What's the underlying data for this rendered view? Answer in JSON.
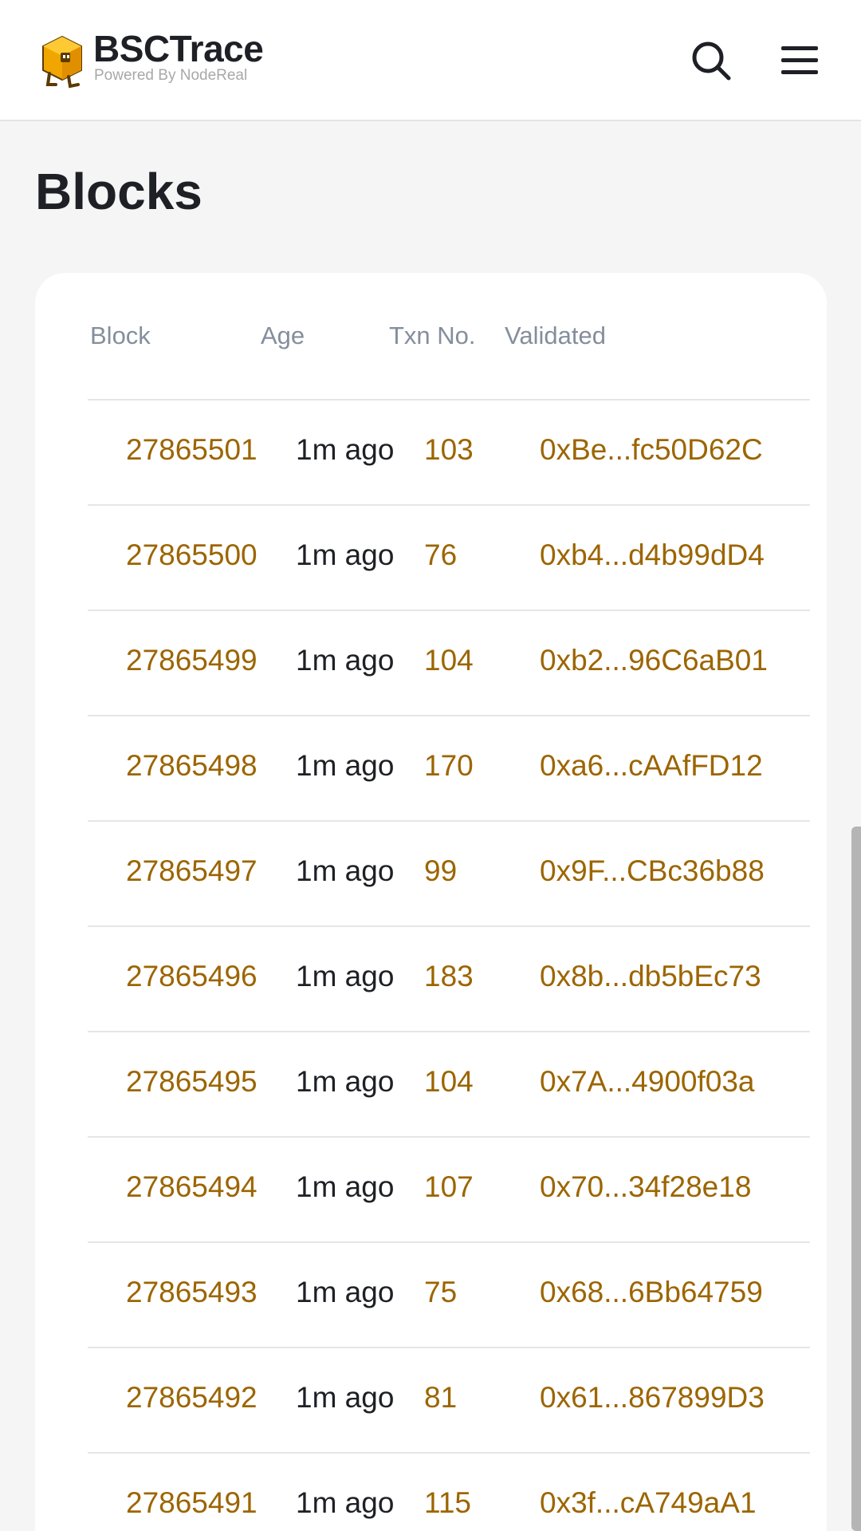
{
  "header": {
    "brand_title": "BSCTrace",
    "brand_subtitle": "Powered By NodeReal",
    "logo_icon": "cube-mascot-icon",
    "search_icon": "search-icon",
    "menu_icon": "hamburger-menu-icon"
  },
  "page": {
    "title": "Blocks"
  },
  "table": {
    "columns": {
      "block": "Block",
      "age": "Age",
      "txn": "Txn No.",
      "validated": "Validated"
    },
    "rows": [
      {
        "block": "27865501",
        "age": "1m ago",
        "txn": "103",
        "validated": "0xBe...fc50D62C"
      },
      {
        "block": "27865500",
        "age": "1m ago",
        "txn": "76",
        "validated": "0xb4...d4b99dD4"
      },
      {
        "block": "27865499",
        "age": "1m ago",
        "txn": "104",
        "validated": "0xb2...96C6aB01"
      },
      {
        "block": "27865498",
        "age": "1m ago",
        "txn": "170",
        "validated": "0xa6...cAAfFD12"
      },
      {
        "block": "27865497",
        "age": "1m ago",
        "txn": "99",
        "validated": "0x9F...CBc36b88"
      },
      {
        "block": "27865496",
        "age": "1m ago",
        "txn": "183",
        "validated": "0x8b...db5bEc73"
      },
      {
        "block": "27865495",
        "age": "1m ago",
        "txn": "104",
        "validated": "0x7A...4900f03a"
      },
      {
        "block": "27865494",
        "age": "1m ago",
        "txn": "107",
        "validated": "0x70...34f28e18"
      },
      {
        "block": "27865493",
        "age": "1m ago",
        "txn": "75",
        "validated": "0x68...6Bb64759"
      },
      {
        "block": "27865492",
        "age": "1m ago",
        "txn": "81",
        "validated": "0x61...867899D3"
      },
      {
        "block": "27865491",
        "age": "1m ago",
        "txn": "115",
        "validated": "0x3f...cA749aA1"
      }
    ]
  },
  "colors": {
    "accent": "#9c6500",
    "text": "#1e2026",
    "muted": "#848e9c",
    "background": "#f5f5f5",
    "logo": "#f0a500"
  }
}
